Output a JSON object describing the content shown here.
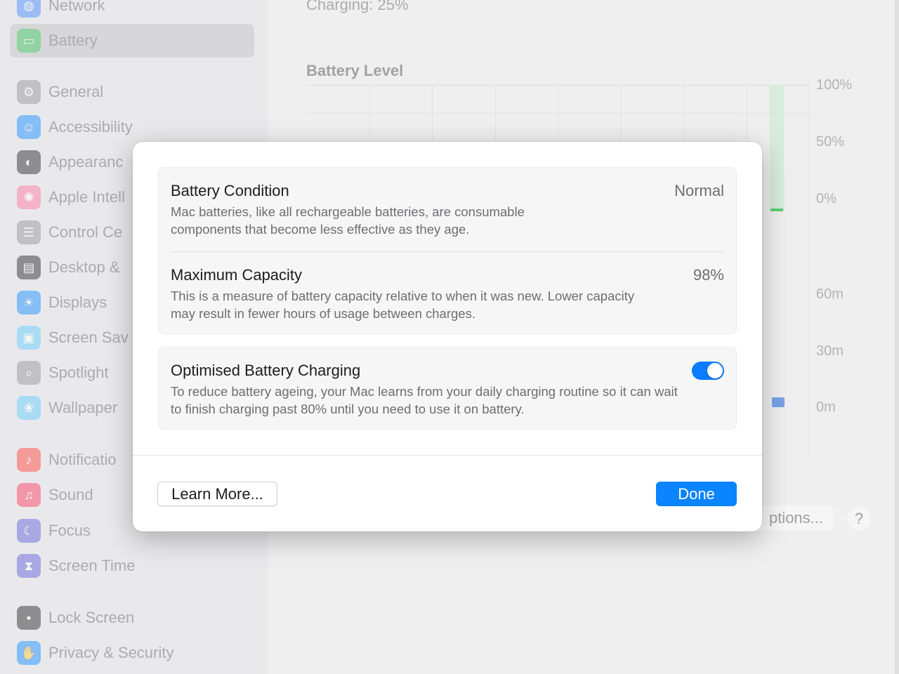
{
  "background": {
    "sidebar": {
      "selected_index": 1,
      "items": [
        {
          "label": "Network",
          "icon": "globe-icon",
          "color": "#3b82f6"
        },
        {
          "label": "Battery",
          "icon": "battery-icon",
          "color": "#34c759"
        },
        {
          "label": "General",
          "icon": "gear-icon",
          "color": "#8e8e93"
        },
        {
          "label": "Accessibility",
          "icon": "accessibility-icon",
          "color": "#0a84ff"
        },
        {
          "label": "Appearanc",
          "icon": "appearance-icon",
          "color": "#1c1c1e"
        },
        {
          "label": "Apple Intell",
          "icon": "apple-intelligence-icon",
          "color": "#ff6b9a"
        },
        {
          "label": "Control Ce",
          "icon": "control-centre-icon",
          "color": "#8e8e93"
        },
        {
          "label": "Desktop &",
          "icon": "desktop-dock-icon",
          "color": "#1c1c1e"
        },
        {
          "label": "Displays",
          "icon": "displays-icon",
          "color": "#0a84ff"
        },
        {
          "label": "Screen Sav",
          "icon": "screen-saver-icon",
          "color": "#5ac8fa"
        },
        {
          "label": "Spotlight",
          "icon": "spotlight-icon",
          "color": "#8e8e93"
        },
        {
          "label": "Wallpaper",
          "icon": "wallpaper-icon",
          "color": "#5ac8fa"
        },
        {
          "label": "Notificatio",
          "icon": "notifications-icon",
          "color": "#ff3b30"
        },
        {
          "label": "Sound",
          "icon": "sound-icon",
          "color": "#ff2d55"
        },
        {
          "label": "Focus",
          "icon": "focus-icon",
          "color": "#5856d6"
        },
        {
          "label": "Screen Time",
          "icon": "screen-time-icon",
          "color": "#5856d6"
        },
        {
          "label": "Lock Screen",
          "icon": "lock-screen-icon",
          "color": "#1c1c1e"
        },
        {
          "label": "Privacy & Security",
          "icon": "privacy-hand-icon",
          "color": "#0a84ff"
        }
      ]
    },
    "main": {
      "charging_status": "Charging: 25%",
      "battery_level_title": "Battery Level",
      "level_axis": [
        "100%",
        "50%",
        "0%"
      ],
      "usage_axis": [
        "60m",
        "30m",
        "0m"
      ],
      "options_button": "ptions...",
      "help_button": "?"
    }
  },
  "modal": {
    "rows": [
      {
        "title": "Battery Condition",
        "value": "Normal",
        "description": "Mac batteries, like all rechargeable batteries, are consumable components that become less effective as they age."
      },
      {
        "title": "Maximum Capacity",
        "value": "98%",
        "description": "This is a measure of battery capacity relative to when it was new. Lower capacity may result in fewer hours of usage between charges."
      },
      {
        "title": "Optimised Battery Charging",
        "toggle_on": true,
        "description": "To reduce battery ageing, your Mac learns from your daily charging routine so it can wait to finish charging past 80% until you need to use it on battery."
      }
    ],
    "learn_more_button": "Learn More...",
    "done_button": "Done",
    "accent_color": "#0a84ff"
  }
}
